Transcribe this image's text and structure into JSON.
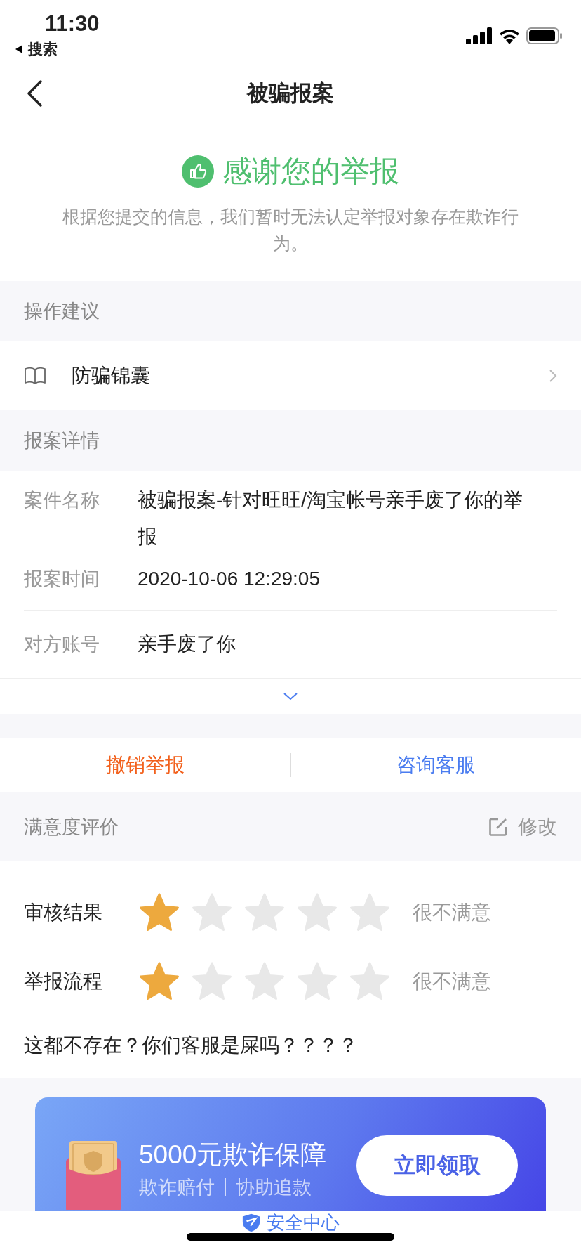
{
  "status_bar": {
    "time": "11:30",
    "back_label": "搜索"
  },
  "nav": {
    "title": "被骗报案"
  },
  "result": {
    "title": "感谢您的举报",
    "message": "根据您提交的信息，我们暂时无法认定举报对象存在欺诈行为。"
  },
  "suggestions": {
    "header": "操作建议",
    "items": [
      {
        "label": "防骗锦囊"
      }
    ]
  },
  "details": {
    "header": "报案详情",
    "expanded": false,
    "field_groups": [
      [
        {
          "label": "案件名称",
          "value": "被骗报案-针对旺旺/淘宝帐号亲手废了你的举报"
        },
        {
          "label": "报案时间",
          "value": "2020-10-06 12:29:05"
        }
      ],
      [
        {
          "label": "对方账号",
          "value": "亲手废了你"
        }
      ]
    ]
  },
  "actions": [
    {
      "label": "撤销举报",
      "kind": "danger"
    },
    {
      "label": "咨询客服",
      "kind": "primary"
    }
  ],
  "rating": {
    "header": "满意度评价",
    "edit_label": "修改",
    "items": [
      {
        "label": "审核结果",
        "stars": 1,
        "verdict": "很不满意"
      },
      {
        "label": "举报流程",
        "stars": 1,
        "verdict": "很不满意"
      }
    ],
    "comment": "这都不存在？你们客服是屎吗？？？？"
  },
  "promo": {
    "title": "5000元欺诈保障",
    "tags": [
      "欺诈赔付",
      "协助追款"
    ],
    "button": "立即领取"
  },
  "tab_bar": {
    "items": [
      {
        "label": "安全中心"
      }
    ]
  }
}
